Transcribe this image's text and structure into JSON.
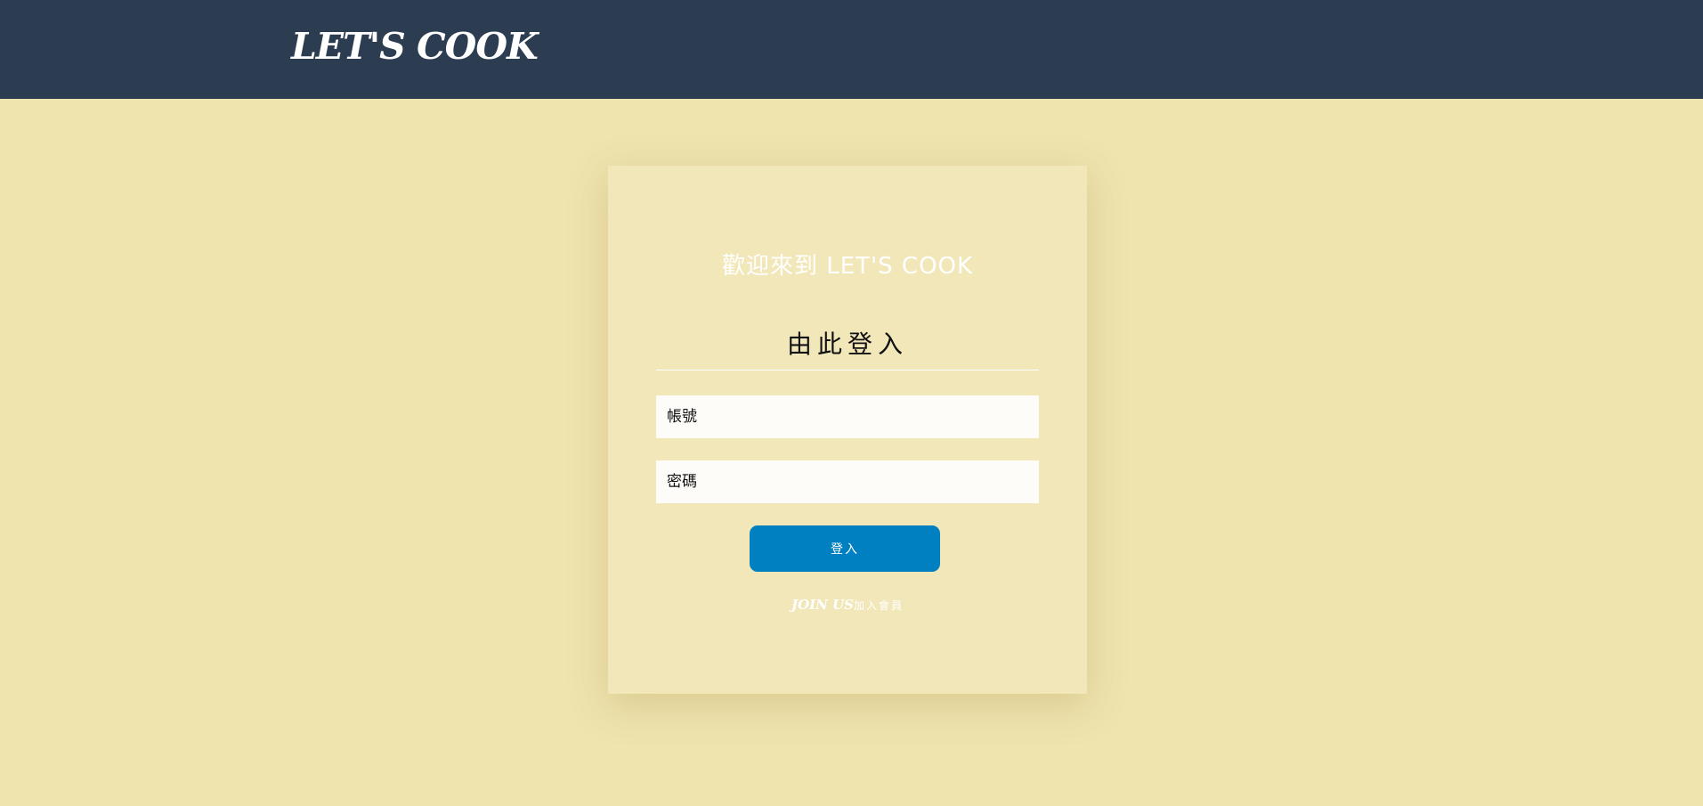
{
  "header": {
    "brand": "LET'S COOK"
  },
  "login_card": {
    "welcome": "歡迎來到 LET'S COOK",
    "heading": "由此登入",
    "account_placeholder": "帳號",
    "password_placeholder": "密碼",
    "login_button": "登入",
    "join_en": "JOIN US",
    "join_zh": "加入會員"
  },
  "colors": {
    "topbar": "#2c3d52",
    "background": "#efe3ae",
    "card": "#f2e7b9",
    "button": "#0080c0"
  }
}
